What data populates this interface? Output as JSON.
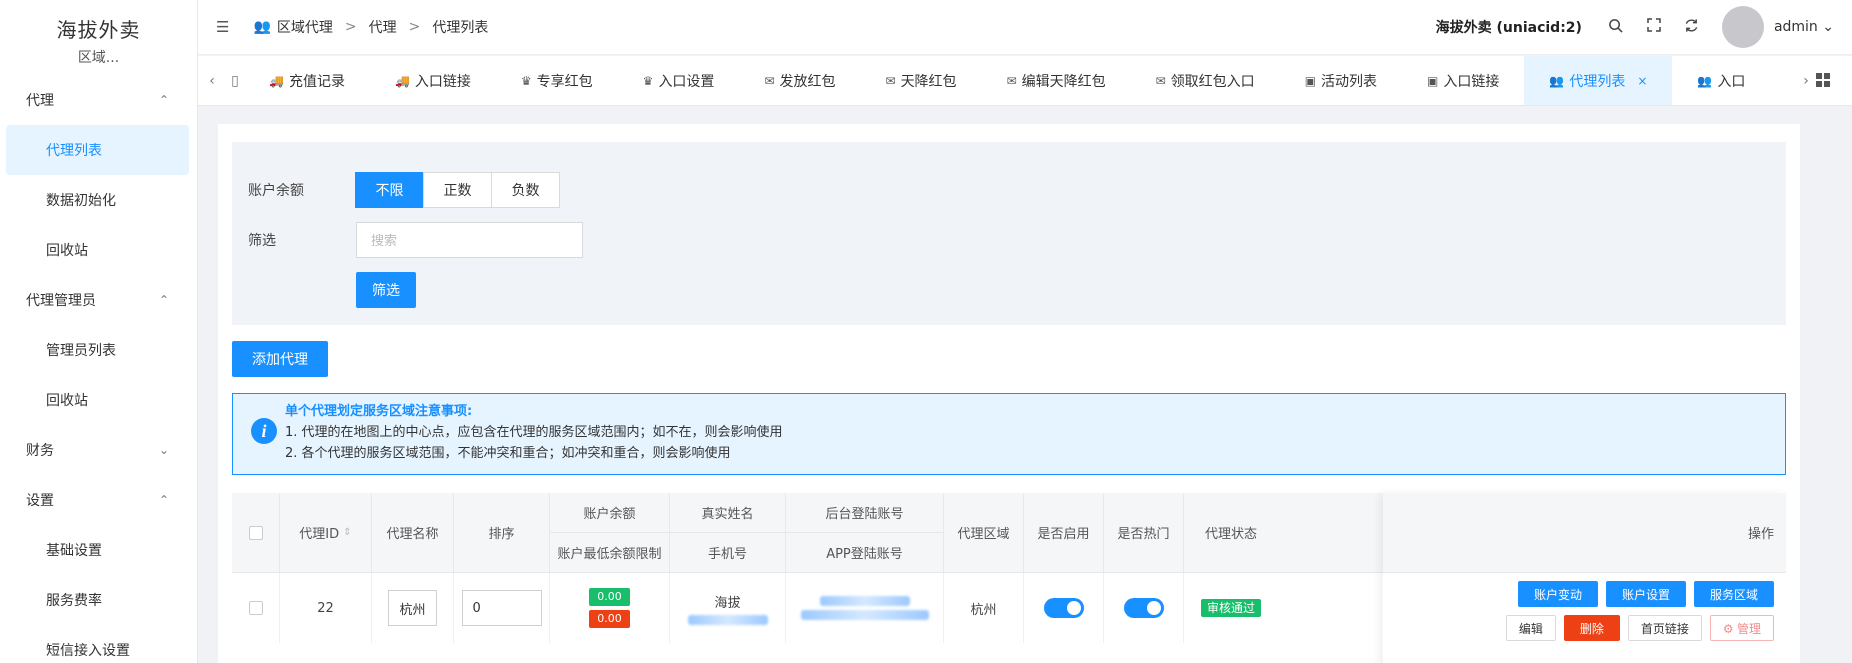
{
  "sidebar": {
    "brand_title": "海拔外卖",
    "brand_sub": "区域...",
    "groups": [
      {
        "label": "代理",
        "items": [
          "代理列表",
          "数据初始化",
          "回收站"
        ]
      },
      {
        "label": "代理管理员",
        "items": [
          "管理员列表",
          "回收站"
        ]
      },
      {
        "label": "财务",
        "items": []
      },
      {
        "label": "设置",
        "items": [
          "基础设置",
          "服务费率",
          "短信接入设置"
        ]
      }
    ],
    "chevrons": {
      "up": "⌃",
      "down": "⌄"
    }
  },
  "topbar": {
    "breadcrumb": [
      "区域代理",
      "代理",
      "代理列表"
    ],
    "app_name": "海拔外卖 (uniacid:2)",
    "user": "admin",
    "icons": [
      "search-icon",
      "fullscreen-icon",
      "refresh-icon"
    ]
  },
  "tabs": [
    {
      "label": "充值记录",
      "icon": "truck-icon"
    },
    {
      "label": "入口链接",
      "icon": "truck-icon"
    },
    {
      "label": "专享红包",
      "icon": "crown-icon"
    },
    {
      "label": "入口设置",
      "icon": "crown-icon"
    },
    {
      "label": "发放红包",
      "icon": "envelope-icon"
    },
    {
      "label": "天降红包",
      "icon": "envelope-icon"
    },
    {
      "label": "编辑天降红包",
      "icon": "envelope-icon"
    },
    {
      "label": "领取红包入口",
      "icon": "envelope-icon"
    },
    {
      "label": "活动列表",
      "icon": "vip-icon"
    },
    {
      "label": "入口链接",
      "icon": "vip-icon"
    },
    {
      "label": "代理列表",
      "icon": "users-icon",
      "active": true
    },
    {
      "label": "入口",
      "icon": "users-icon"
    }
  ],
  "filter": {
    "balance_label": "账户余额",
    "balance_options": [
      "不限",
      "正数",
      "负数"
    ],
    "balance_selected": "不限",
    "screen_label": "筛选",
    "search_placeholder": "搜索",
    "search_value": "",
    "filter_button": "筛选"
  },
  "add_button": "添加代理",
  "notice": {
    "title": "单个代理划定服务区域注意事项:",
    "lines": [
      "1. 代理的在地图上的中心点，应包含在代理的服务区域范围内；如不在，则会影响使用",
      "2. 各个代理的服务区域范围，不能冲突和重合；如冲突和重合，则会影响使用"
    ]
  },
  "table": {
    "headers": {
      "id": "代理ID",
      "name": "代理名称",
      "sort": "排序",
      "balance": "账户余额",
      "min_balance": "账户最低余额限制",
      "real_name": "真实姓名",
      "phone": "手机号",
      "backend_account": "后台登陆账号",
      "app_account": "APP登陆账号",
      "region": "代理区域",
      "enabled": "是否启用",
      "hot": "是否热门",
      "status": "代理状态",
      "ops": "操作"
    },
    "rows": [
      {
        "id": "22",
        "name": "杭州",
        "sort": "0",
        "balance": "0.00",
        "min_balance": "0.00",
        "real_name": "海拔",
        "region": "杭州",
        "enabled": true,
        "hot": true,
        "status": "审核通过"
      }
    ],
    "actions": {
      "row1": [
        "账户变动",
        "账户设置",
        "服务区域"
      ],
      "row2": [
        "编辑",
        "删除",
        "首页链接",
        "管理"
      ]
    }
  },
  "colors": {
    "primary": "#1890ff",
    "success": "#19be6b",
    "danger": "#ed4014"
  }
}
